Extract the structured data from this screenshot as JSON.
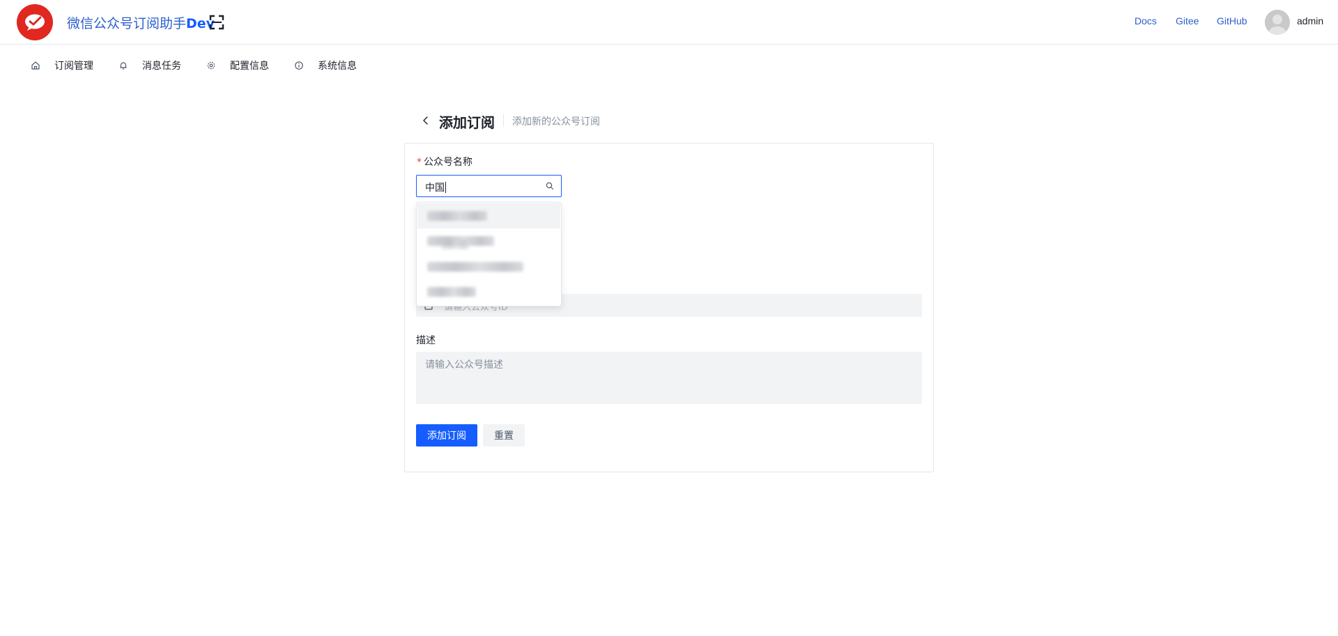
{
  "header": {
    "app_title_prefix": "微信公众号订阅助手",
    "app_title_suffix": "Dev",
    "links": [
      "Docs",
      "Gitee",
      "GitHub"
    ],
    "username": "admin"
  },
  "nav": {
    "items": [
      {
        "label": "订阅管理",
        "icon": "home-icon"
      },
      {
        "label": "消息任务",
        "icon": "bell-icon"
      },
      {
        "label": "配置信息",
        "icon": "gear-icon"
      },
      {
        "label": "系统信息",
        "icon": "info-icon"
      }
    ]
  },
  "page": {
    "title": "添加订阅",
    "subtitle": "添加新的公众号订阅"
  },
  "form": {
    "name_label": "公众号名称",
    "required_mark": "*",
    "search_value": "中国",
    "id_placeholder": "请输入公众号ID",
    "desc_label": "描述",
    "desc_placeholder": "请输入公众号描述",
    "submit_label": "添加订阅",
    "reset_label": "重置"
  },
  "colors": {
    "primary": "#165dff",
    "logo": "#e02720",
    "link": "#2b5fce",
    "required": "#f53f3f"
  }
}
